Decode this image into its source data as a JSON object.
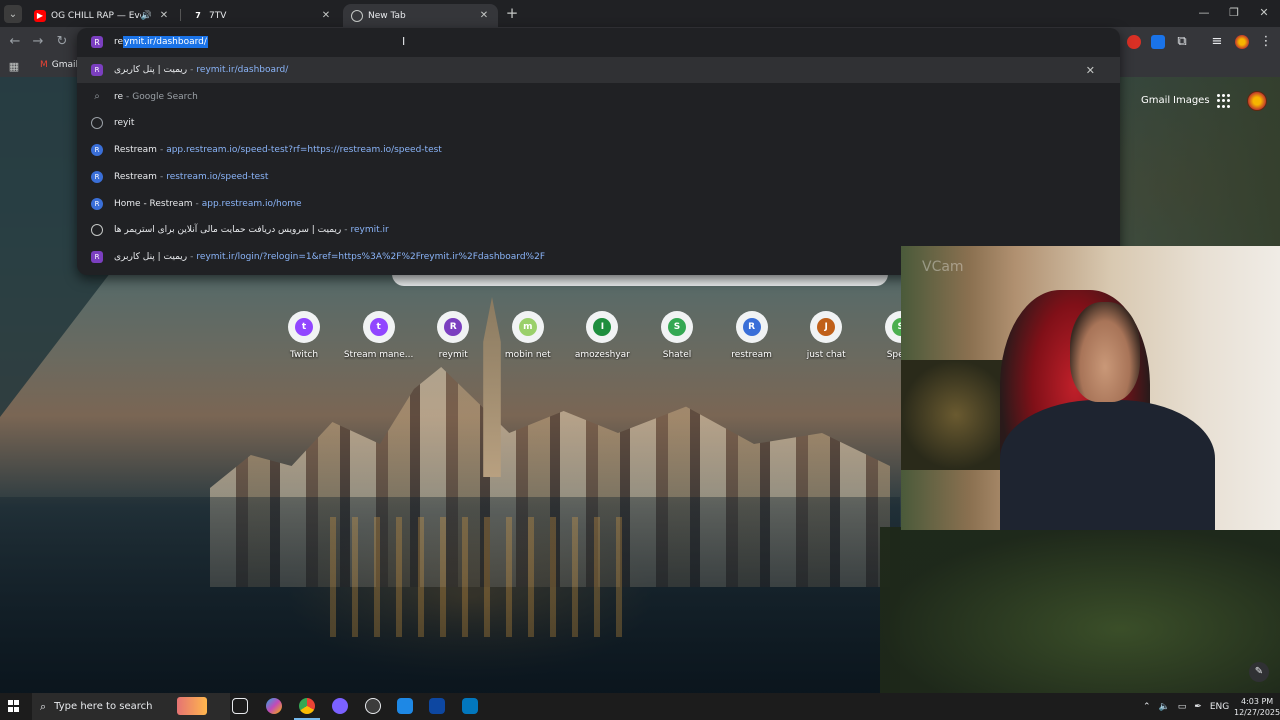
{
  "tabs": [
    {
      "title": "OG CHILL RAP — Everyday",
      "favicon": "youtube-icon"
    },
    {
      "title": "7TV",
      "favicon": "7tv-icon"
    },
    {
      "title": "New Tab",
      "favicon": "chrome-icon",
      "active": true
    }
  ],
  "omnibox": {
    "typed": "re",
    "completion": "ymit.ir/dashboard/",
    "suggestions": [
      {
        "main": "ریمیت | پنل کاربری",
        "url": "reymit.ir/dashboard/",
        "icon": "reymit-icon",
        "selected": true
      },
      {
        "main": "re",
        "desc": "Google Search",
        "icon": "search-icon"
      },
      {
        "main": "reyit",
        "icon": "history-icon"
      },
      {
        "main": "Restream",
        "url": "app.restream.io/speed-test?rf=https://restream.io/speed-test",
        "icon": "restream-icon"
      },
      {
        "main": "Restream",
        "url": "restream.io/speed-test",
        "icon": "restream-icon"
      },
      {
        "main": "Home - Restream",
        "url": "app.restream.io/home",
        "icon": "restream-icon"
      },
      {
        "main": "ریمیت | سرویس دریافت حمایت مالی آنلاین برای استریمر ها",
        "url": "reymit.ir",
        "icon": "globe-icon"
      },
      {
        "main": "ریمیت | پنل کاربری",
        "url": "reymit.ir/login/?relogin=1&ref=https%3A%2F%2Freymit.ir%2Fdashboard%2F",
        "icon": "reymit-icon"
      }
    ]
  },
  "bookmarks": {
    "gmail": "Gmail"
  },
  "google_header": {
    "gmail": "Gmail",
    "images": "Images"
  },
  "shortcuts": [
    {
      "label": "Twitch",
      "color": "#9146ff",
      "glyph": "t"
    },
    {
      "label": "Stream mane...",
      "color": "#9146ff",
      "glyph": "t"
    },
    {
      "label": "reymit",
      "color": "#7b3fc0",
      "glyph": "R"
    },
    {
      "label": "mobin net",
      "color": "#9ad06a",
      "glyph": "m"
    },
    {
      "label": "amozeshyar",
      "color": "#1e8e3e",
      "glyph": "I"
    },
    {
      "label": "Shatel",
      "color": "#34a853",
      "glyph": "S"
    },
    {
      "label": "restream",
      "color": "#3a6fd8",
      "glyph": "R"
    },
    {
      "label": "just chat",
      "color": "#c0601a",
      "glyph": "J"
    },
    {
      "label": "Speed",
      "color": "#4caf50",
      "glyph": "S"
    }
  ],
  "webcam": {
    "label": "VCam"
  },
  "taskbar": {
    "search_placeholder": "Type here to search",
    "language": "ENG",
    "time": "4:03 PM",
    "date": "12/27/2025"
  }
}
